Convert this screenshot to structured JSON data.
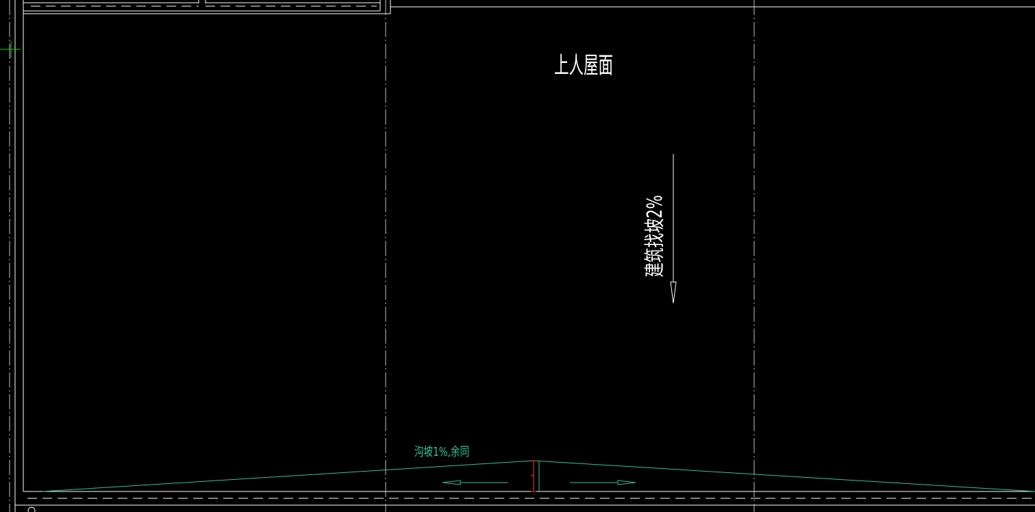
{
  "drawing": {
    "title_label": "上人屋面",
    "slope_note_vertical": "建筑找坡2%",
    "gutter_slope_note": "沟坡1%,余同",
    "colors": {
      "background": "#000000",
      "wall_lines": "#ffffff",
      "axis_lines": "#bfbfbf",
      "gutter_lines": "#2fc79a",
      "accent_red": "#ff3b1f",
      "crosshair": "#22cc22"
    },
    "icons": {
      "slope_arrow_down": "arrow-down-icon",
      "gutter_arrow_left": "arrow-left-icon",
      "gutter_arrow_right": "arrow-right-icon",
      "cursor": "crosshair-icon"
    }
  }
}
